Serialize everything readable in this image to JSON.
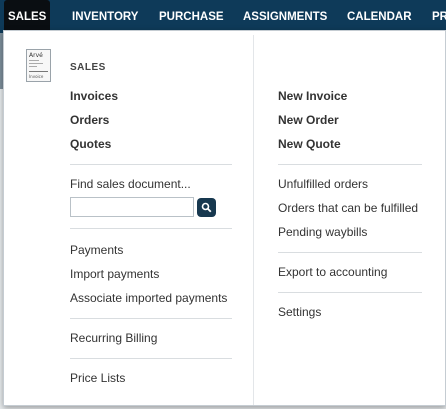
{
  "topnav": {
    "items": [
      "SALES",
      "INVENTORY",
      "PURCHASE",
      "ASSIGNMENTS",
      "CALENDAR",
      "PR"
    ]
  },
  "menu": {
    "section_title": "SALES",
    "left": {
      "primary": [
        "Invoices",
        "Orders",
        "Quotes"
      ],
      "find_label": "Find sales document...",
      "search_value": "",
      "group2": [
        "Payments",
        "Import payments",
        "Associate imported payments"
      ],
      "group3": [
        "Recurring Billing"
      ],
      "group4": [
        "Price Lists"
      ]
    },
    "right": {
      "primary": [
        "New Invoice",
        "New Order",
        "New Quote"
      ],
      "group2": [
        "Unfulfilled orders",
        "Orders that can be fulfilled",
        "Pending waybills"
      ],
      "group3": [
        "Export to accounting"
      ],
      "group4": [
        "Settings"
      ]
    },
    "doc_icon_text": [
      "Arvé",
      "Invoice"
    ]
  },
  "colors": {
    "nav_bg": "#0e3a59",
    "nav_active_bg": "#0a0e12",
    "search_button": "#17384f"
  }
}
